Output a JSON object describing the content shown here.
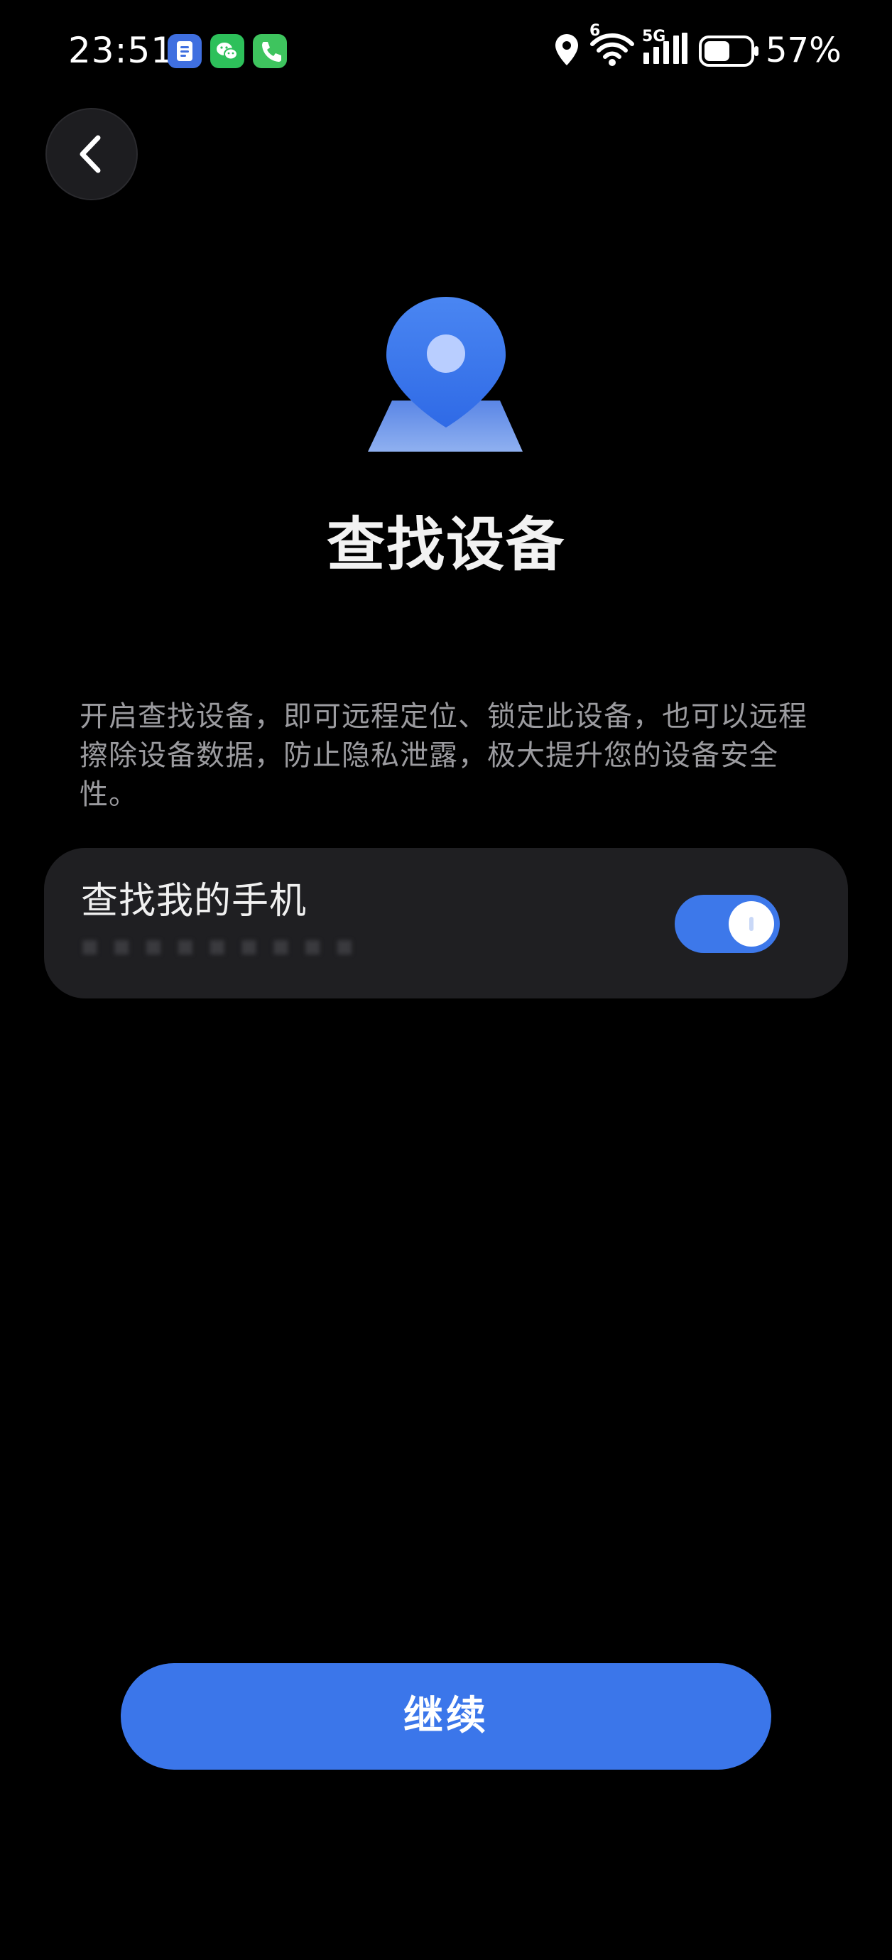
{
  "status_bar": {
    "time": "23:51",
    "battery_percent": "57%",
    "network_label": "5G",
    "wifi_badge": "6",
    "notification_icons": [
      "notes-app-icon",
      "wechat-icon",
      "phone-call-icon"
    ],
    "battery_level": 0.57
  },
  "page": {
    "title": "查找设备",
    "description": "开启查找设备，即可远程定位、锁定此设备，也可以远程擦除设备数据，防止隐私泄露，极大提升您的设备安全性。"
  },
  "setting": {
    "label": "查找我的手机",
    "enabled": true
  },
  "actions": {
    "continue_label": "继续"
  },
  "colors": {
    "accent": "#3b76ea",
    "background": "#000000",
    "card": "#1f1f22",
    "secondary_text": "#9b9b9f"
  }
}
